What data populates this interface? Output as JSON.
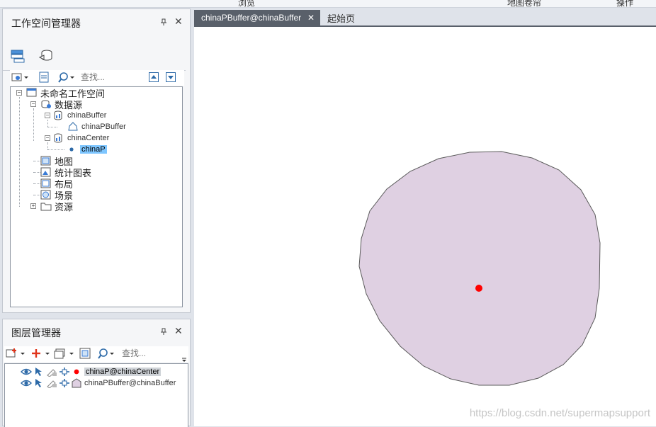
{
  "top_strip": {
    "items": [
      "浏览",
      "地图卷帘",
      "操作"
    ]
  },
  "workspace_panel": {
    "title": "工作空间管理器",
    "search_placeholder": "查找...",
    "tree": {
      "root": "未命名工作空间",
      "datasources": "数据源",
      "ds1": "chinaBuffer",
      "ds1_child": "chinaPBuffer",
      "ds2": "chinaCenter",
      "ds2_child": "chinaP",
      "maps": "地图",
      "charts": "统计图表",
      "layouts": "布局",
      "scenes": "场景",
      "resources": "资源"
    }
  },
  "layer_panel": {
    "title": "图层管理器",
    "search_placeholder": "查找...",
    "layers": [
      {
        "name": "chinaP@chinaCenter",
        "selected": true,
        "type": "point"
      },
      {
        "name": "chinaPBuffer@chinaBuffer",
        "selected": false,
        "type": "region"
      }
    ]
  },
  "doc_tabs": [
    {
      "label": "chinaPBuffer@chinaBuffer",
      "active": true,
      "close": "✕"
    },
    {
      "label": "起始页",
      "active": false
    }
  ],
  "map": {
    "buffer_fill": "#dfd0e2",
    "buffer_stroke": "#5a5a5a",
    "point_color": "#ff0000"
  },
  "watermark": "https://blog.csdn.net/supermapsupport",
  "colors": {
    "selection": "#7ec6ff",
    "active_tab": "#59606a",
    "panel_bg": "#f5f6f8"
  }
}
